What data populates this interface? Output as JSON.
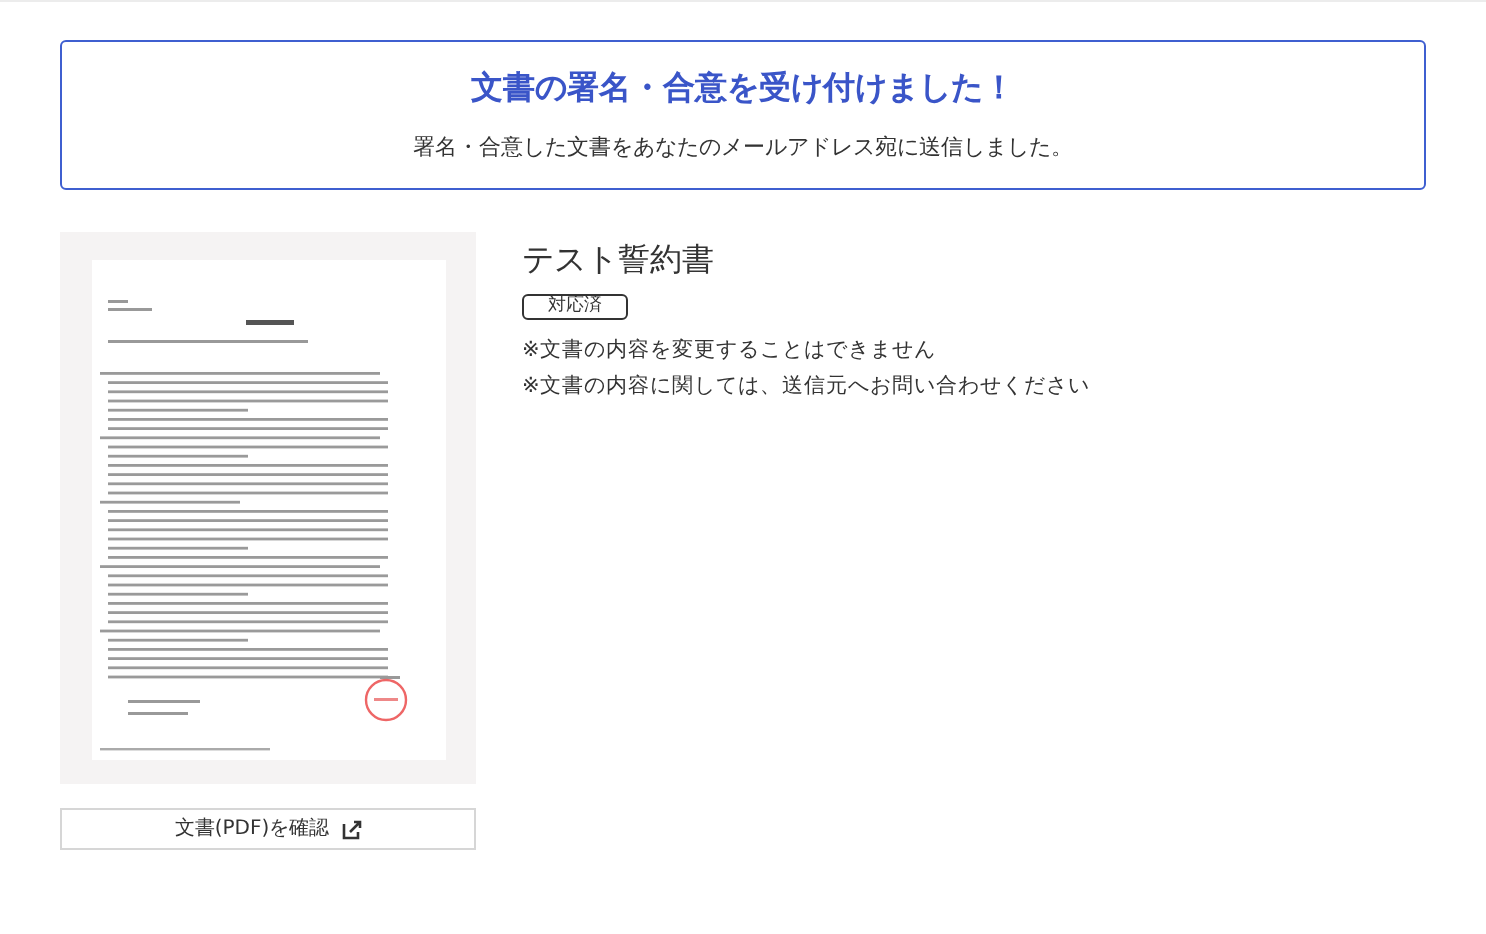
{
  "banner": {
    "title": "文書の署名・合意を受け付けました！",
    "message": "署名・合意した文書をあなたのメールアドレス宛に送信しました。"
  },
  "document": {
    "open_button": "文書(PDF)を確認",
    "title": "テスト誓約書",
    "status": "対応済",
    "notes": [
      "※文書の内容を変更することはできません",
      "※文書の内容に関しては、送信元へお問い合わせください"
    ]
  }
}
